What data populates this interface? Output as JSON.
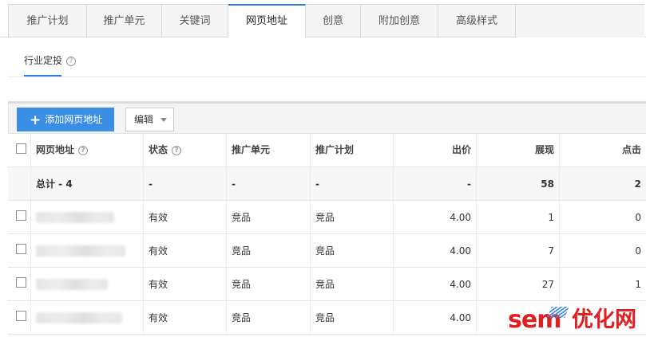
{
  "tabs": [
    {
      "label": "推广计划",
      "active": false
    },
    {
      "label": "推广单元",
      "active": false
    },
    {
      "label": "关键词",
      "active": false
    },
    {
      "label": "网页地址",
      "active": true
    },
    {
      "label": "创意",
      "active": false
    },
    {
      "label": "附加创意",
      "active": false
    },
    {
      "label": "高级样式",
      "active": false
    }
  ],
  "subtab": {
    "label": "行业定投",
    "help": "?"
  },
  "toolbar": {
    "add_label": "添加网页地址",
    "add_icon": "plus-icon",
    "edit_label": "编辑",
    "edit_icon": "caret-down-icon"
  },
  "table": {
    "headers": {
      "url": "网页地址",
      "url_help": "?",
      "status": "状态",
      "status_help": "?",
      "unit": "推广单元",
      "plan": "推广计划",
      "bid": "出价",
      "impressions": "展现",
      "clicks": "点击"
    },
    "total": {
      "label": "总计 - 4",
      "status": "-",
      "unit": "-",
      "plan": "-",
      "bid": "-",
      "impressions": "58",
      "clicks": "2"
    },
    "rows": [
      {
        "status": "有效",
        "unit": "竞品",
        "plan": "竞品",
        "bid": "4.00",
        "impressions": "1",
        "clicks": "0"
      },
      {
        "status": "有效",
        "unit": "竞品",
        "plan": "竞品",
        "bid": "4.00",
        "impressions": "7",
        "clicks": "0"
      },
      {
        "status": "有效",
        "unit": "竞品",
        "plan": "竞品",
        "bid": "4.00",
        "impressions": "27",
        "clicks": "1"
      },
      {
        "status": "有效",
        "unit": "竞品",
        "plan": "竞品",
        "bid": "4.00",
        "impressions": "",
        "clicks": ""
      }
    ]
  },
  "watermark": {
    "brand": "sem",
    "suffix": "优化网"
  },
  "colors": {
    "accent": "#2b7fe1",
    "button": "#3a8ee6",
    "watermark": "#e02020"
  }
}
